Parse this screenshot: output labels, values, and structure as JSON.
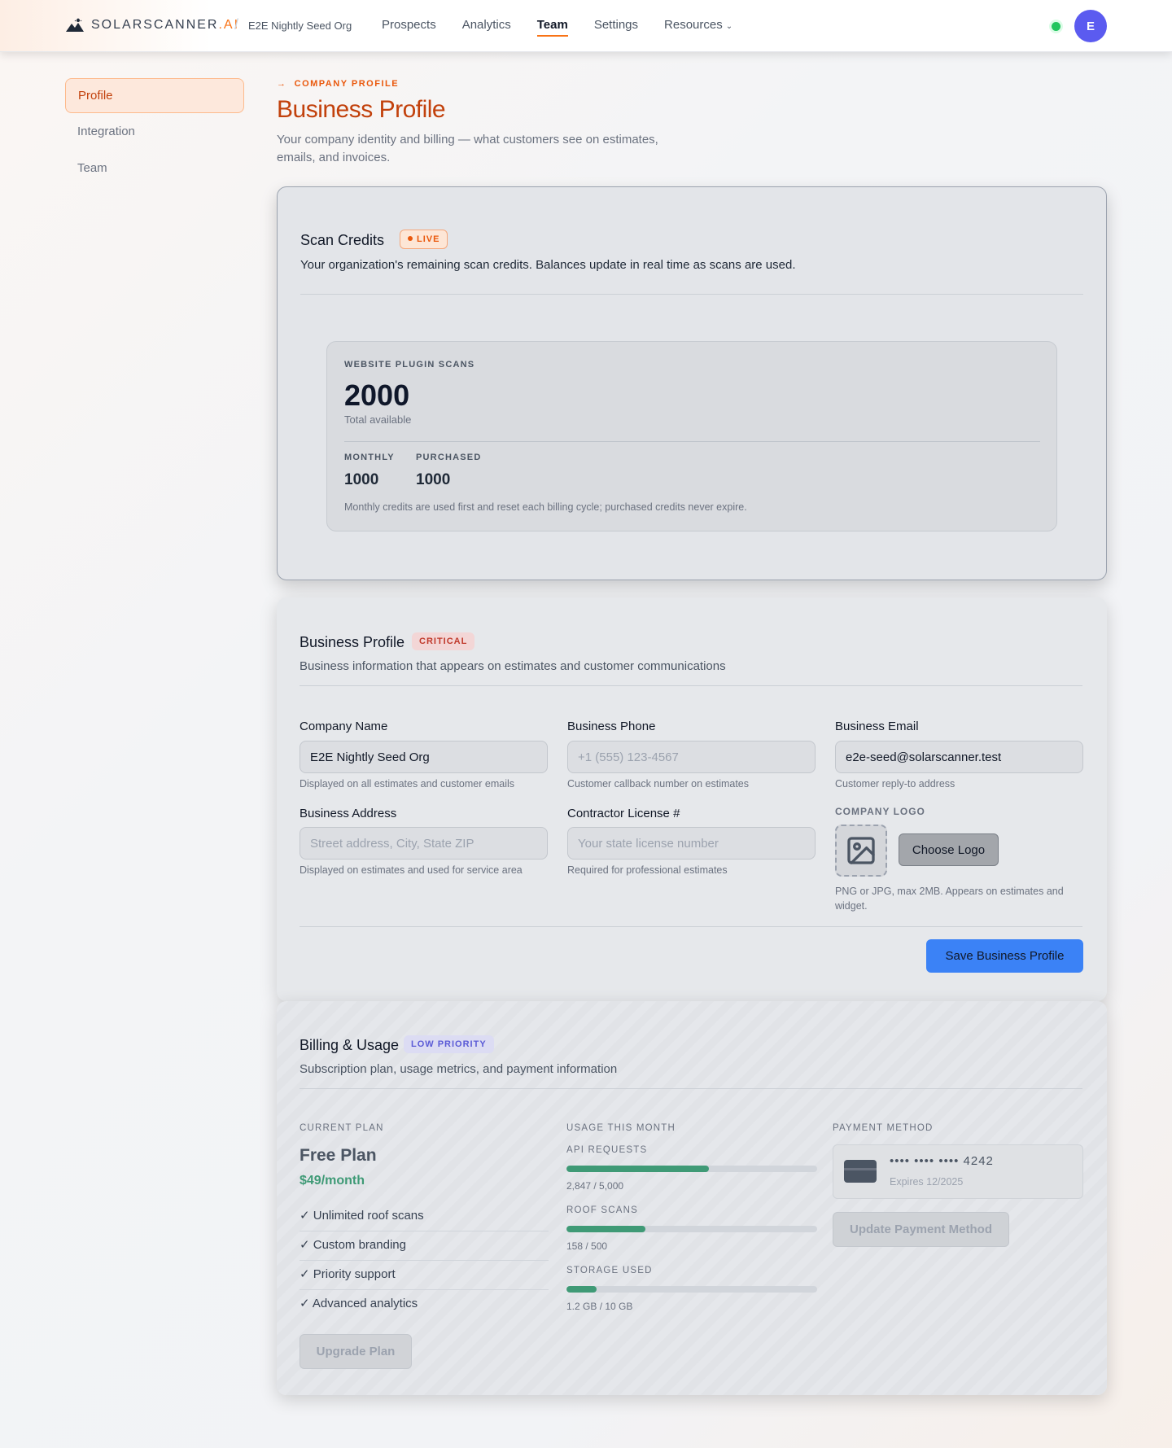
{
  "nav": {
    "brand_main": "SOLARSCANNER",
    "brand_suffix": ".AI",
    "separator": "/",
    "org_name": "E2E Nightly Seed Org",
    "links": [
      "Prospects",
      "Analytics",
      "Team",
      "Settings",
      "Resources"
    ],
    "active_link": "Team",
    "resources_chevron": "chevron-down-icon",
    "avatar_initial": "E",
    "status_color": "#22c55e"
  },
  "sidebar": {
    "items": [
      {
        "label": "Profile",
        "active": true
      },
      {
        "label": "Integration",
        "active": false
      },
      {
        "label": "Team",
        "active": false
      }
    ]
  },
  "header": {
    "eyebrow_arrow": "→",
    "eyebrow": "COMPANY PROFILE",
    "title": "Business Profile",
    "subtitle": "Your company identity and billing — what customers see on estimates, emails, and invoices."
  },
  "scan_credits": {
    "title": "Scan Credits",
    "badge": "LIVE",
    "description": "Your organization's remaining scan credits. Balances update in real time as scans are used.",
    "box_label": "WEBSITE PLUGIN SCANS",
    "total": "2000",
    "total_caption": "Total available",
    "monthly_label": "MONTHLY",
    "monthly_value": "1000",
    "purchased_label": "PURCHASED",
    "purchased_value": "1000",
    "note": "Monthly credits are used first and reset each billing cycle; purchased credits never expire."
  },
  "business_profile": {
    "title": "Business Profile",
    "badge": "CRITICAL",
    "description": "Business information that appears on estimates and customer communications",
    "fields": {
      "company_name": {
        "label": "Company Name",
        "value": "E2E Nightly Seed Org",
        "placeholder": "",
        "help": "Displayed on all estimates and customer emails"
      },
      "business_phone": {
        "label": "Business Phone",
        "value": "",
        "placeholder": "+1 (555) 123-4567",
        "help": "Customer callback number on estimates"
      },
      "business_email": {
        "label": "Business Email",
        "value": "e2e-seed@solarscanner.test",
        "placeholder": "",
        "help": "Customer reply-to address"
      },
      "business_address": {
        "label": "Business Address",
        "value": "",
        "placeholder": "Street address, City, State ZIP",
        "help": "Displayed on estimates and used for service area"
      },
      "license": {
        "label": "Contractor License #",
        "value": "",
        "placeholder": "Your state license number",
        "help": "Required for professional estimates"
      }
    },
    "logo_label": "COMPANY LOGO",
    "logo_icon": "image-icon",
    "choose_logo": "Choose Logo",
    "logo_help": "PNG or JPG, max 2MB. Appears on estimates and widget.",
    "save_button": "Save Business Profile"
  },
  "billing": {
    "title": "Billing & Usage",
    "badge": "LOW PRIORITY",
    "description": "Subscription plan, usage metrics, and payment information",
    "current_plan_label": "CURRENT PLAN",
    "plan_name": "Free Plan",
    "plan_price": "$49/month",
    "features": [
      "✓ Unlimited roof scans",
      "✓ Custom branding",
      "✓ Priority support",
      "✓ Advanced analytics"
    ],
    "upgrade_button": "Upgrade Plan",
    "usage_label": "USAGE THIS MONTH",
    "meters": [
      {
        "label": "API REQUESTS",
        "value_text": "2,847 / 5,000",
        "fraction": 0.569
      },
      {
        "label": "ROOF SCANS",
        "value_text": "158 / 500",
        "fraction": 0.316
      },
      {
        "label": "STORAGE USED",
        "value_text": "1.2 GB / 10 GB",
        "fraction": 0.12
      }
    ],
    "payment_label": "PAYMENT METHOD",
    "card_icon": "credit-card-icon",
    "card_number": "•••• •••• •••• 4242",
    "card_expiry": "Expires 12/2025",
    "update_button": "Update Payment Method",
    "accent_color": "#3f9a76"
  }
}
